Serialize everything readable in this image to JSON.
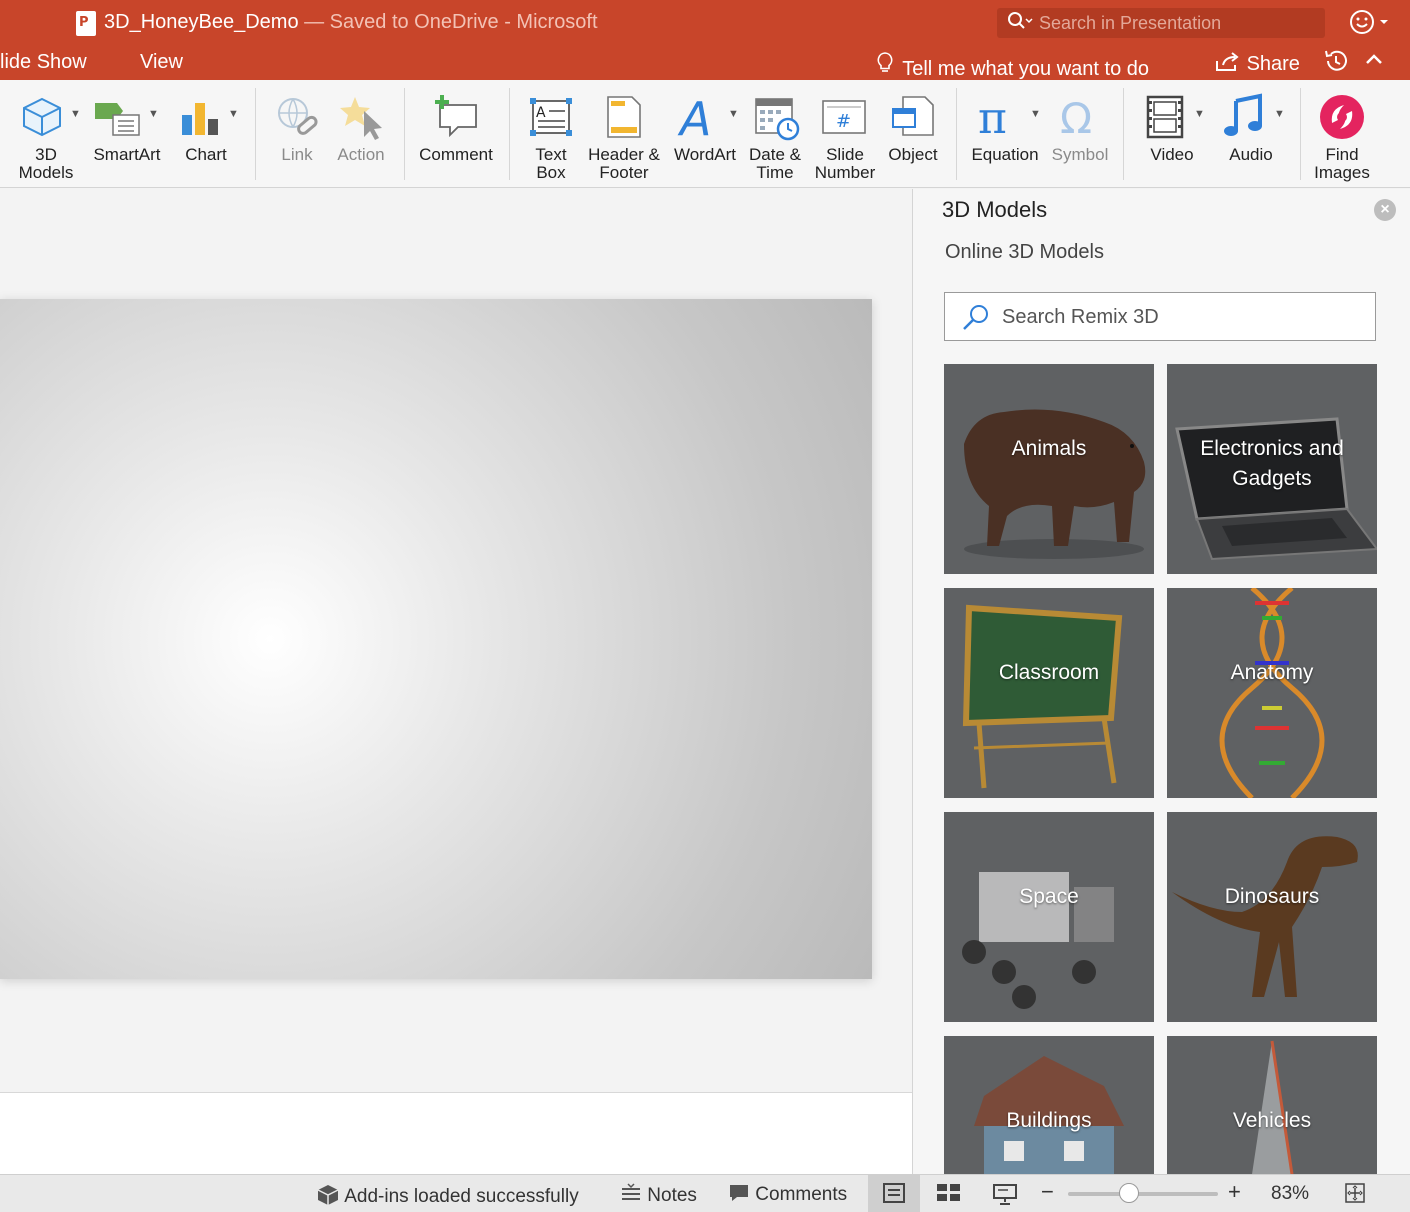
{
  "titlebar": {
    "doc_name": "3D_HoneyBee_Demo",
    "save_status": " — Saved to OneDrive - Microsoft",
    "search_placeholder": "Search in Presentation"
  },
  "tabs": {
    "slide_show": "lide Show",
    "view": "View",
    "tell_me": "Tell me what you want to do",
    "share": "Share"
  },
  "ribbon": {
    "items": [
      {
        "label": "3D\nModels"
      },
      {
        "label": "SmartArt"
      },
      {
        "label": "Chart"
      },
      {
        "label": "Link"
      },
      {
        "label": "Action"
      },
      {
        "label": "Comment"
      },
      {
        "label": "Text\nBox"
      },
      {
        "label": "Header &\nFooter"
      },
      {
        "label": "WordArt"
      },
      {
        "label": "Date &\nTime"
      },
      {
        "label": "Slide\nNumber"
      },
      {
        "label": "Object"
      },
      {
        "label": "Equation"
      },
      {
        "label": "Symbol"
      },
      {
        "label": "Video"
      },
      {
        "label": "Audio"
      },
      {
        "label": "Find\nImages"
      }
    ]
  },
  "pane": {
    "title": "3D Models",
    "subtitle": "Online 3D Models",
    "search_placeholder": "Search Remix 3D",
    "categories": [
      {
        "label": "Animals"
      },
      {
        "label": "Electronics and Gadgets"
      },
      {
        "label": "Classroom"
      },
      {
        "label": "Anatomy"
      },
      {
        "label": "Space"
      },
      {
        "label": "Dinosaurs"
      },
      {
        "label": "Buildings"
      },
      {
        "label": "Vehicles"
      }
    ]
  },
  "statusbar": {
    "addins": "Add-ins loaded successfully",
    "notes": "Notes",
    "comments": "Comments",
    "zoom": "83%",
    "zoom_level_percent": 83
  },
  "colors": {
    "accent": "#c8452a",
    "tile_bg": "#5e6062"
  }
}
